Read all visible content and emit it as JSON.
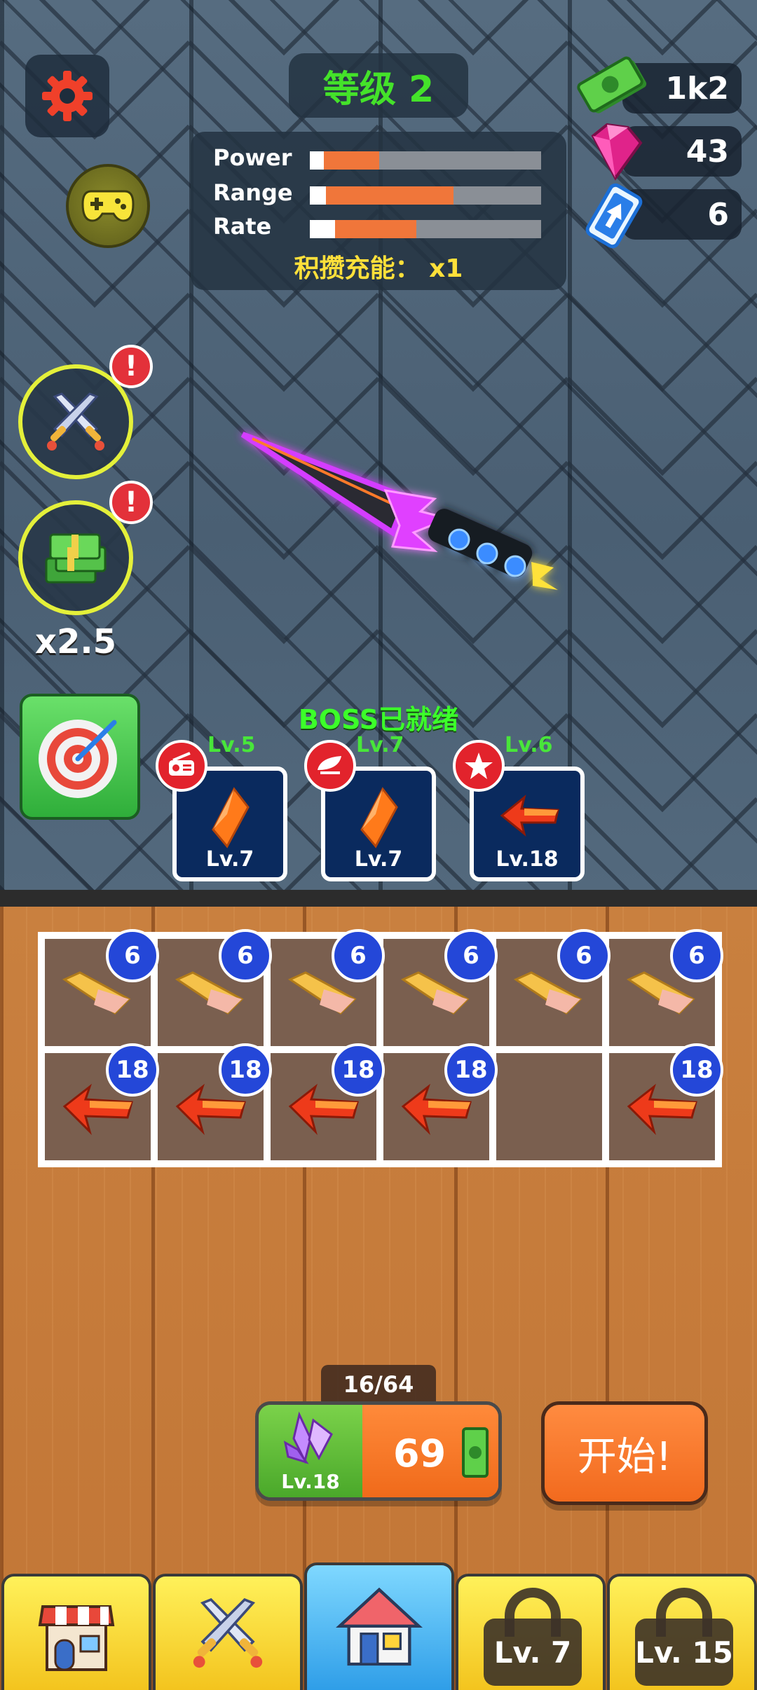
{
  "header": {
    "level_text": "等级 2",
    "stats": [
      {
        "label": "Power",
        "white": 0.06,
        "orange": 0.3
      },
      {
        "label": "Range",
        "white": 0.07,
        "orange": 0.62
      },
      {
        "label": "Rate",
        "white": 0.11,
        "orange": 0.46
      }
    ],
    "charge_text": "积攒充能： x1"
  },
  "currencies": {
    "cash": "1k2",
    "gems": "43",
    "tickets": "6"
  },
  "side": {
    "multiplier": "x2.5",
    "alert_mark": "!"
  },
  "boss": {
    "ready_text": "BOSS已就绪"
  },
  "turrets": [
    {
      "top_level": "Lv.5",
      "bottom_level": "Lv.7",
      "badge_icon": "radio-icon"
    },
    {
      "top_level": "Lv.7",
      "bottom_level": "Lv.7",
      "badge_icon": "bullet-icon"
    },
    {
      "top_level": "Lv.6",
      "bottom_level": "Lv.18",
      "badge_icon": "star-icon"
    }
  ],
  "grid": {
    "rows": [
      [
        "6",
        "6",
        "6",
        "6",
        "6",
        "6"
      ],
      [
        "18",
        "18",
        "18",
        "18",
        "",
        "18"
      ]
    ]
  },
  "buy": {
    "capacity": "16/64",
    "crystal_level": "Lv.18",
    "price": "69"
  },
  "start_label": "开始!",
  "nav": {
    "locked_1": "Lv. 7",
    "locked_2": "Lv. 15"
  },
  "colors": {
    "accent_green": "#44e22a",
    "bar_orange": "#f0763a",
    "badge_blue": "#2447d8",
    "alert_red": "#e3313a"
  }
}
